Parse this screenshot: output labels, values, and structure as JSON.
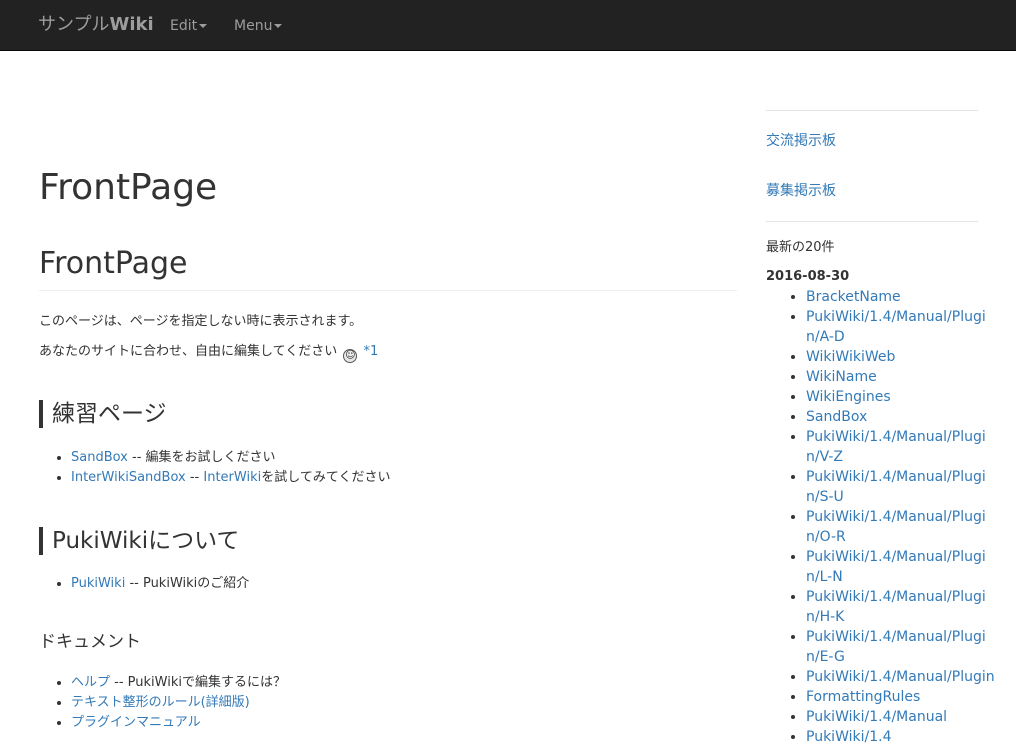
{
  "navbar": {
    "brand_prefix": "サンプル",
    "brand_wiki": "Wiki",
    "edit_label": "Edit",
    "menu_label": "Menu"
  },
  "main": {
    "page_title": "FrontPage",
    "heading": "FrontPage",
    "para1": "このページは、ページを指定しない時に表示されます。",
    "para2": "あなたのサイトに合わせ、自由に編集してください",
    "footnote_ref": "*1",
    "sections": {
      "practice": {
        "title": "練習ページ",
        "items": [
          {
            "link": "SandBox",
            "text": " -- 編集をお試しください"
          },
          {
            "link": "InterWikiSandBox",
            "sep": " -- ",
            "link2": "InterWiki",
            "text": "を試してみてください"
          }
        ]
      },
      "about": {
        "title": "PukiWikiについて",
        "items": [
          {
            "link": "PukiWiki",
            "text": " -- PukiWikiのご紹介"
          }
        ]
      },
      "docs": {
        "title": "ドキュメント",
        "items": [
          {
            "link": "ヘルプ",
            "text": " -- PukiWikiで編集するには？"
          },
          {
            "link": "テキスト整形のルール(詳細版)",
            "text": ""
          },
          {
            "link": "プラグインマニュアル",
            "text": ""
          }
        ]
      }
    }
  },
  "sidebar": {
    "links": [
      "交流掲示板",
      "募集掲示板"
    ],
    "recent_label": "最新の20件",
    "date": "2016-08-30",
    "recent": [
      "BracketName",
      "PukiWiki/1.4/Manual/Plugin/A-D",
      "WikiWikiWeb",
      "WikiName",
      "WikiEngines",
      "SandBox",
      "PukiWiki/1.4/Manual/Plugin/V-Z",
      "PukiWiki/1.4/Manual/Plugin/S-U",
      "PukiWiki/1.4/Manual/Plugin/O-R",
      "PukiWiki/1.4/Manual/Plugin/L-N",
      "PukiWiki/1.4/Manual/Plugin/H-K",
      "PukiWiki/1.4/Manual/Plugin/E-G",
      "PukiWiki/1.4/Manual/Plugin",
      "FormattingRules",
      "PukiWiki/1.4/Manual",
      "PukiWiki/1.4"
    ]
  }
}
